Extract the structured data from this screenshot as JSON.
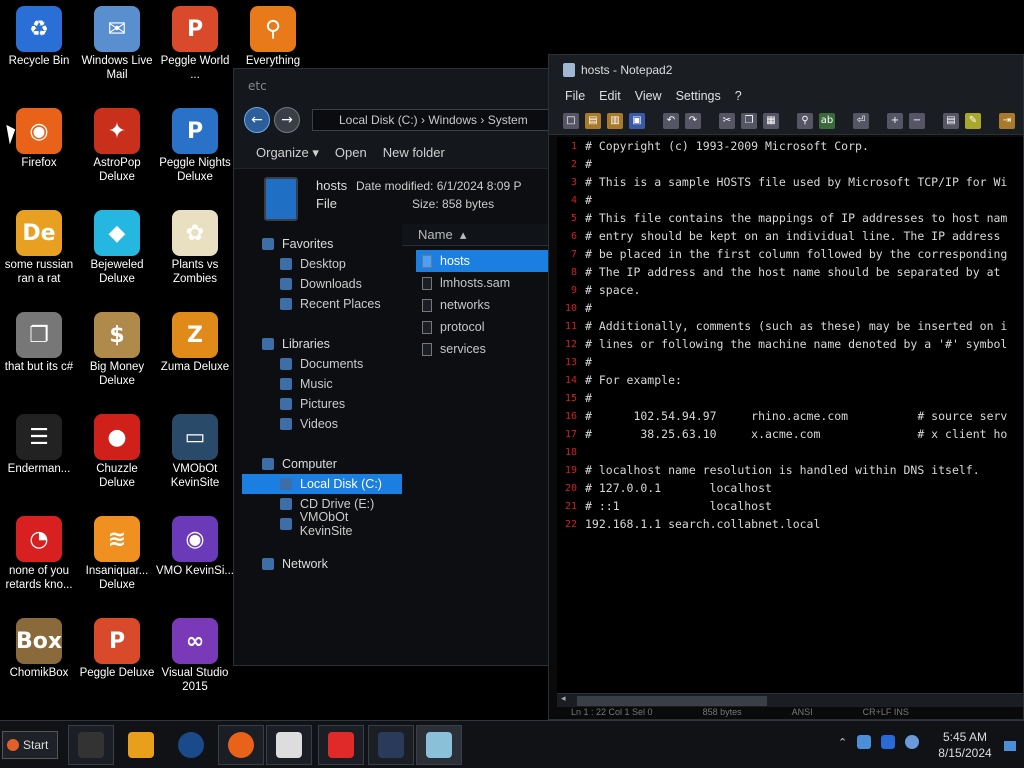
{
  "desktop": {
    "icons": [
      {
        "label": "Recycle Bin",
        "icon": "recycle-bin-icon",
        "color": "#2a6fd6",
        "glyph": "♻"
      },
      {
        "label": "Windows Live Mail",
        "icon": "mail-icon",
        "color": "#5a8fcf",
        "glyph": "✉"
      },
      {
        "label": "Peggle World ...",
        "icon": "peggle-icon",
        "color": "#d94a2a",
        "glyph": "P"
      },
      {
        "label": "Everything",
        "icon": "magnifier-icon",
        "color": "#e87a1a",
        "glyph": "⚲"
      },
      {
        "label": "Firefox",
        "icon": "firefox-icon",
        "color": "#e8621a",
        "glyph": "◉"
      },
      {
        "label": "AstroPop Deluxe",
        "icon": "astropop-icon",
        "color": "#c8301c",
        "glyph": "✦"
      },
      {
        "label": "Peggle Nights Deluxe",
        "icon": "peggle-nights-icon",
        "color": "#2a72c8",
        "glyph": "P"
      },
      {
        "label": "some russian ran a rat",
        "icon": "de-icon",
        "color": "#e8a020",
        "glyph": "De"
      },
      {
        "label": "Bejeweled Deluxe",
        "icon": "gem-icon",
        "color": "#25b7e0",
        "glyph": "◆"
      },
      {
        "label": "Plants vs Zombies",
        "icon": "flower-icon",
        "color": "#e8e0c0",
        "glyph": "✿"
      },
      {
        "label": "that but its c#",
        "icon": "windows-stack-icon",
        "color": "#777777",
        "glyph": "❐"
      },
      {
        "label": "Big Money Deluxe",
        "icon": "money-bag-icon",
        "color": "#b08a4a",
        "glyph": "$"
      },
      {
        "label": "Zuma Deluxe",
        "icon": "zuma-icon",
        "color": "#e08a1a",
        "glyph": "Z"
      },
      {
        "label": "Enderman...",
        "icon": "console-icon",
        "color": "#222222",
        "glyph": "☰"
      },
      {
        "label": "Chuzzle Deluxe",
        "icon": "chuzzle-icon",
        "color": "#d0201a",
        "glyph": "●"
      },
      {
        "label": "VMObOt KevinSite",
        "icon": "monitor-icon",
        "color": "#2a4a6a",
        "glyph": "▭"
      },
      {
        "label": "none of you retards kno...",
        "icon": "red-creature-icon",
        "color": "#d82020",
        "glyph": "◔"
      },
      {
        "label": "Insaniquar... Deluxe",
        "icon": "fish-icon",
        "color": "#f09020",
        "glyph": "≋"
      },
      {
        "label": "VMO KevinSi...",
        "icon": "firefox-file-icon",
        "color": "#6a3ab8",
        "glyph": "◉"
      },
      {
        "label": "ChomikBox",
        "icon": "hamster-icon",
        "color": "#8a6a3a",
        "glyph": "Box"
      },
      {
        "label": "Peggle Deluxe",
        "icon": "peggle-deluxe-icon",
        "color": "#d94a2a",
        "glyph": "P"
      },
      {
        "label": "Visual Studio 2015",
        "icon": "visual-studio-icon",
        "color": "#7a3ab8",
        "glyph": "∞"
      }
    ]
  },
  "explorer": {
    "title": "etc",
    "address": "Local Disk (C:)  ›  Windows  ›  System",
    "toolbar": {
      "organize": "Organize ▾",
      "open": "Open",
      "new_folder": "New folder"
    },
    "details": {
      "name": "hosts",
      "date_label": "Date modified:",
      "date": "6/1/2024 8:09 P",
      "type": "File",
      "size_label": "Size:",
      "size": "858 bytes"
    },
    "nav": {
      "favorites": "Favorites",
      "favorites_items": [
        "Desktop",
        "Downloads",
        "Recent Places"
      ],
      "libraries": "Libraries",
      "libraries_items": [
        "Documents",
        "Music",
        "Pictures",
        "Videos"
      ],
      "computer": "Computer",
      "computer_items": [
        "Local Disk (C:)",
        "CD Drive (E:)",
        "VMObOt KevinSite"
      ],
      "network": "Network"
    },
    "column_header": "Name",
    "files": [
      "hosts",
      "lmhosts.sam",
      "networks",
      "protocol",
      "services"
    ]
  },
  "notepad": {
    "title": "hosts - Notepad2",
    "menu": [
      "File",
      "Edit",
      "View",
      "Settings",
      "?"
    ],
    "lines": [
      "# Copyright (c) 1993-2009 Microsoft Corp.",
      "#",
      "# This is a sample HOSTS file used by Microsoft TCP/IP for Wi",
      "#",
      "# This file contains the mappings of IP addresses to host nam",
      "# entry should be kept on an individual line. The IP address ",
      "# be placed in the first column followed by the corresponding",
      "# The IP address and the host name should be separated by at ",
      "# space.",
      "#",
      "# Additionally, comments (such as these) may be inserted on i",
      "# lines or following the machine name denoted by a '#' symbol",
      "#",
      "# For example:",
      "#",
      "#      102.54.94.97     rhino.acme.com          # source serv",
      "#       38.25.63.10     x.acme.com              # x client ho",
      "",
      "# localhost name resolution is handled within DNS itself.",
      "# 127.0.0.1       localhost",
      "# ::1             localhost",
      "192.168.1.1 search.collabnet.local"
    ],
    "status": [
      "Ln 1 : 22   Col 1   Sel 0",
      "858 bytes",
      "ANSI",
      "CR+LF   INS"
    ]
  },
  "taskbar": {
    "start": "Start",
    "clock_time": "5:45 AM",
    "clock_date": "8/15/2024"
  }
}
